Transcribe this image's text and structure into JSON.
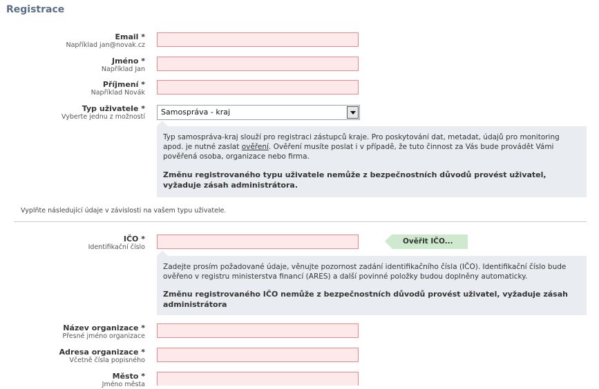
{
  "page": {
    "title": "Registrace"
  },
  "fields": {
    "email": {
      "label": "Email *",
      "hint": "Například jan@novak.cz",
      "value": ""
    },
    "jmeno": {
      "label": "Jméno *",
      "hint": "Například Jan",
      "value": ""
    },
    "prijmeni": {
      "label": "Příjmení *",
      "hint": "Například Novák",
      "value": ""
    },
    "typ": {
      "label": "Typ uživatele *",
      "hint": "Vyberte jednu z možností",
      "selected": "Samospráva - kraj"
    },
    "ico": {
      "label": "IČO *",
      "hint": "Identifikační číslo",
      "value": ""
    },
    "nazev": {
      "label": "Název organizace *",
      "hint": "Přesné jméno organizace",
      "value": ""
    },
    "adresa": {
      "label": "Adresa organizace *",
      "hint": "Včetně čísla popisného",
      "value": ""
    },
    "mesto": {
      "label": "Město *",
      "hint": "Jméno města",
      "value": ""
    }
  },
  "info_typ": {
    "text_before": "Typ samospráva-kraj slouží pro registraci zástupců kraje. Pro poskytování dat, metadat, údajů pro monitoring apod. je nutné zaslat ",
    "link": "ověření",
    "text_after": ". Ověření musíte poslat i v případě, že tuto činnost za Vás bude provádět Vámi pověřená osoba, organizace nebo firma.",
    "warning": "Změnu registrovaného typu uživatele nemůže z bezpečnostních důvodů provést uživatel, vyžaduje zásah administrátora."
  },
  "instruction": "Vyplňte následující údaje v závislosti na vašem typu uživatele.",
  "ico_verify_button": "Ověřit IČO...",
  "info_ico": {
    "text": "Zadejte prosím požadované údaje, věnujte pozornost zadání identifikačního čísla (IČO). Identifikační číslo bude ověřeno v registru ministerstva financí (ARES) a další povinné položky budou doplněny automaticky.",
    "warning": "Změnu registrovaného IČO nemůže z bezpečnostních důvodů provést uživatel, vyžaduje zásah administrátora"
  },
  "colors": {
    "title": "#5a6e88",
    "required_input_bg": "#fde9e9",
    "required_input_border": "#e58a8a",
    "info_bg": "#e9ecf0",
    "verify_button_bg": "#cfe9cf"
  }
}
